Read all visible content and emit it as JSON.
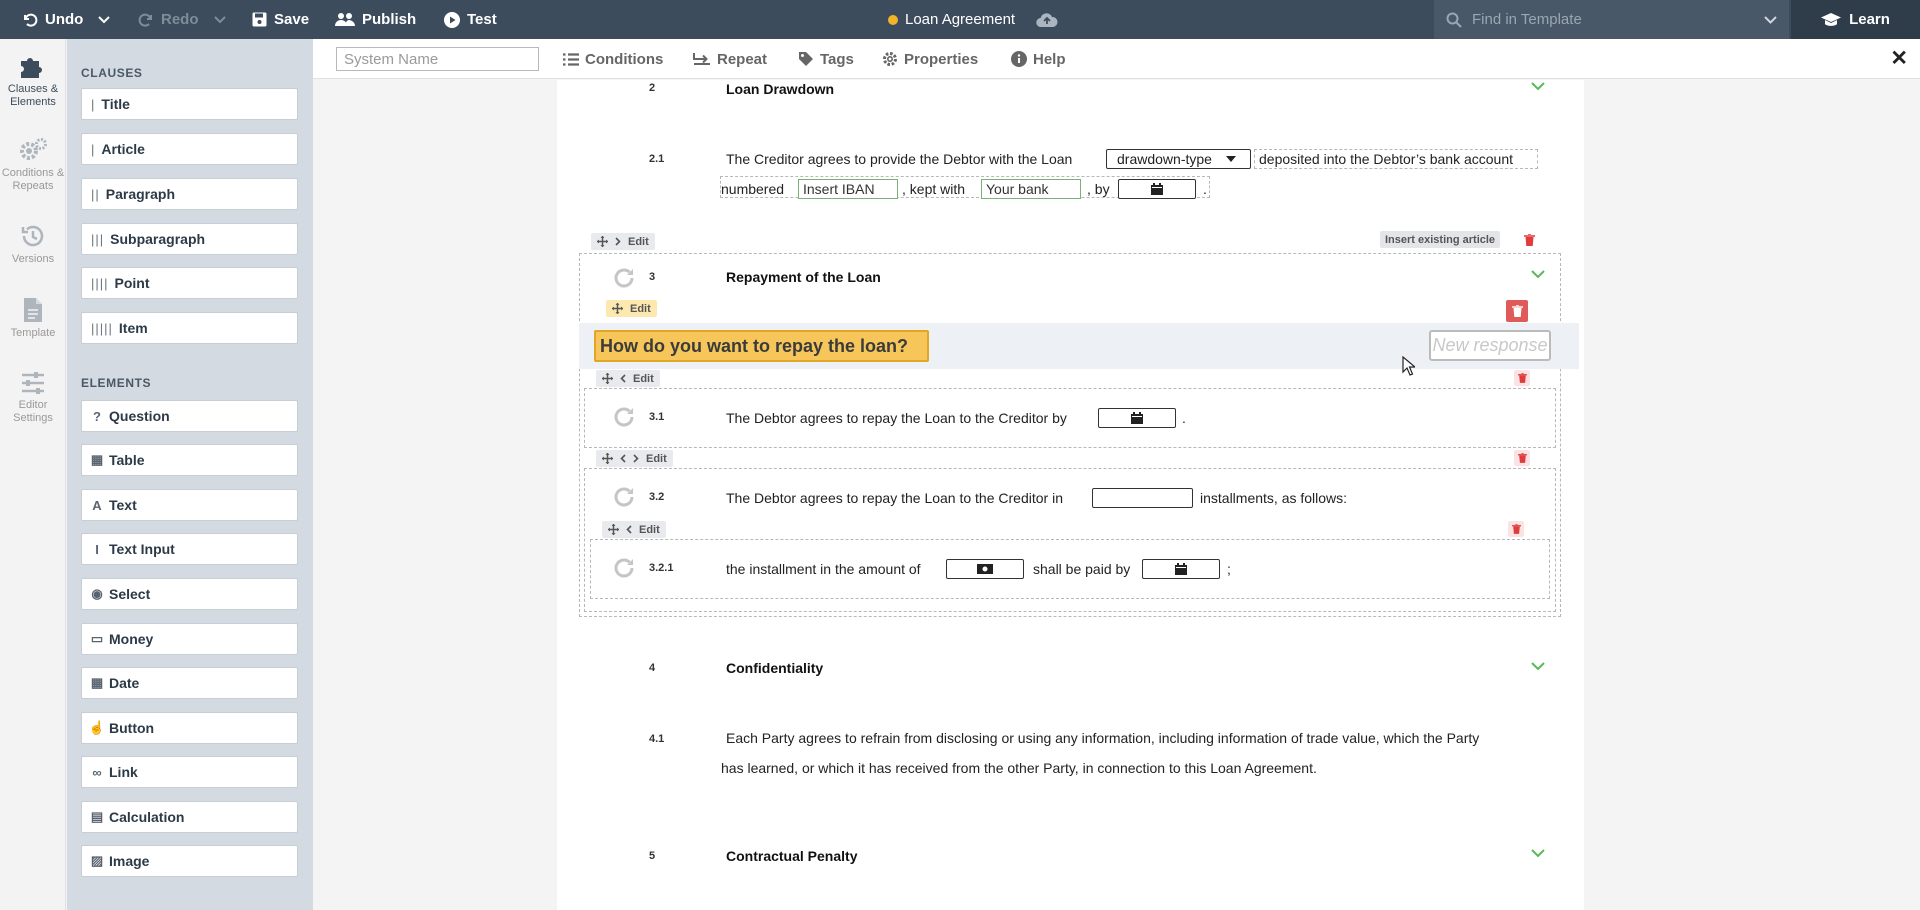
{
  "topbar": {
    "undo": "Undo",
    "redo": "Redo",
    "save": "Save",
    "publish": "Publish",
    "test": "Test",
    "doc_title": "Loan Agreement",
    "find_placeholder": "Find in Template",
    "learn": "Learn"
  },
  "toolbar": {
    "system_name_placeholder": "System Name",
    "conditions": "Conditions",
    "repeat": "Repeat",
    "tags": "Tags",
    "properties": "Properties",
    "help": "Help"
  },
  "rail": [
    {
      "label": "Clauses & Elements",
      "icon": "puzzle-icon"
    },
    {
      "label": "Conditions & Repeats",
      "icon": "gears-icon"
    },
    {
      "label": "Versions",
      "icon": "history-icon"
    },
    {
      "label": "Template",
      "icon": "file-icon"
    },
    {
      "label": "Editor Settings",
      "icon": "sliders-icon"
    }
  ],
  "palette": {
    "clauses_heading": "CLAUSES",
    "clauses": [
      {
        "bars": "|",
        "label": "Title"
      },
      {
        "bars": "|",
        "label": "Article"
      },
      {
        "bars": "||",
        "label": "Paragraph"
      },
      {
        "bars": "|||",
        "label": "Subparagraph"
      },
      {
        "bars": "||||",
        "label": "Point"
      },
      {
        "bars": "|||||",
        "label": "Item"
      }
    ],
    "elements_heading": "ELEMENTS",
    "elements": [
      {
        "icon": "question-icon",
        "glyph": "?",
        "label": "Question"
      },
      {
        "icon": "table-icon",
        "glyph": "▦",
        "label": "Table"
      },
      {
        "icon": "text-icon",
        "glyph": "A",
        "label": "Text"
      },
      {
        "icon": "text-input-icon",
        "glyph": "I",
        "label": "Text Input"
      },
      {
        "icon": "select-icon",
        "glyph": "◉",
        "label": "Select"
      },
      {
        "icon": "money-icon",
        "glyph": "▭",
        "label": "Money"
      },
      {
        "icon": "calendar-icon",
        "glyph": "▦",
        "label": "Date"
      },
      {
        "icon": "pointer-icon",
        "glyph": "☝",
        "label": "Button"
      },
      {
        "icon": "link-icon",
        "glyph": "∞",
        "label": "Link"
      },
      {
        "icon": "calculator-icon",
        "glyph": "▤",
        "label": "Calculation"
      },
      {
        "icon": "image-icon",
        "glyph": "▨",
        "label": "Image"
      }
    ]
  },
  "doc": {
    "s2": {
      "num": "2",
      "title": "Loan Drawdown"
    },
    "s21": {
      "num": "2.1",
      "t1": "The Creditor agrees to provide the Debtor with the Loan",
      "select": "drawdown-type",
      "t2": "deposited into the Debtor’s bank account",
      "t3": "numbered",
      "iban": "Insert IBAN",
      "t4": ", kept with",
      "bank": "Your bank",
      "t5": ", by",
      "t6": "."
    },
    "edit": "Edit",
    "insert_existing": "Insert existing article",
    "s3": {
      "num": "3",
      "title": "Repayment of the Loan"
    },
    "question": "How do you want to repay the loan?",
    "new_response": "New response",
    "s31": {
      "num": "3.1",
      "t1": "The Debtor agrees to repay the Loan to the Creditor by",
      "t2": "."
    },
    "s32": {
      "num": "3.2",
      "t1": "The Debtor agrees to repay the Loan to the Creditor in",
      "t2": "installments, as follows:"
    },
    "s321": {
      "num": "3.2.1",
      "t1": "the installment in the amount of",
      "t2": "shall be paid by",
      "t3": ";"
    },
    "s4": {
      "num": "4",
      "title": "Confidentiality"
    },
    "s41": {
      "num": "4.1",
      "line1": "Each Party agrees to refrain from disclosing or using any information, including information of trade value, which the Party",
      "line2": "has learned, or which it has received from the other Party, in connection to this Loan Agreement."
    },
    "s5": {
      "num": "5",
      "title": "Contractual Penalty"
    }
  },
  "colors": {
    "topbar": "#3d4c5c",
    "palette_bg": "#d4dae2",
    "question_highlight": "#f6c65a",
    "chevron_green": "#5cb85c",
    "delete_red": "#e03c3c",
    "unsaved_dot": "#f0b429"
  }
}
